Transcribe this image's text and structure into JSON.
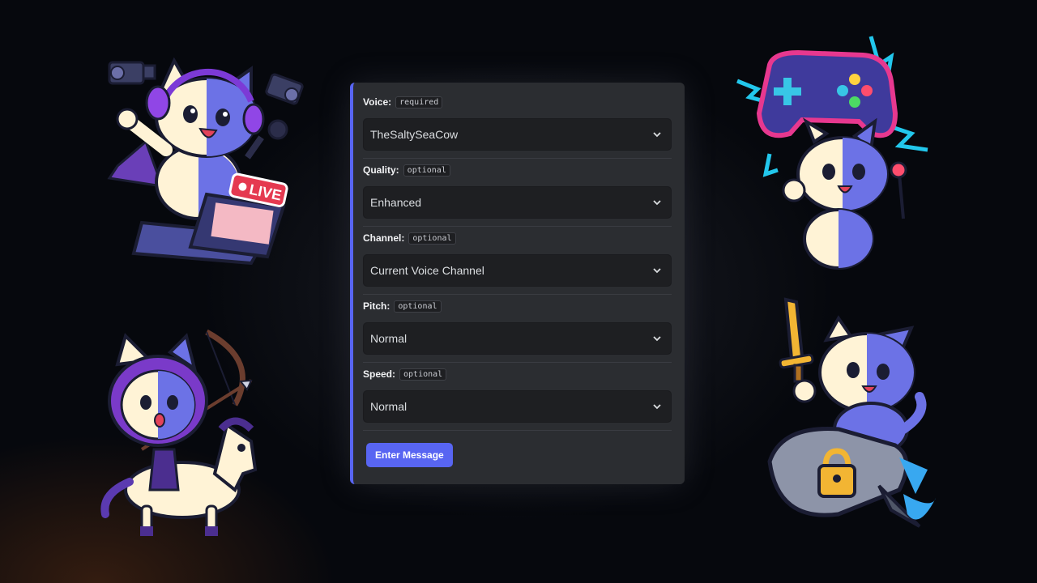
{
  "form": {
    "fields": [
      {
        "label": "Voice:",
        "tag": "required",
        "value": "TheSaltySeaCow"
      },
      {
        "label": "Quality:",
        "tag": "optional",
        "value": "Enhanced"
      },
      {
        "label": "Channel:",
        "tag": "optional",
        "value": "Current Voice Channel"
      },
      {
        "label": "Pitch:",
        "tag": "optional",
        "value": "Normal"
      },
      {
        "label": "Speed:",
        "tag": "optional",
        "value": "Normal"
      }
    ],
    "submit_label": "Enter Message",
    "accent_color": "#5865f2"
  },
  "stickers": {
    "streamer": {
      "badge_text": "LIVE"
    }
  }
}
